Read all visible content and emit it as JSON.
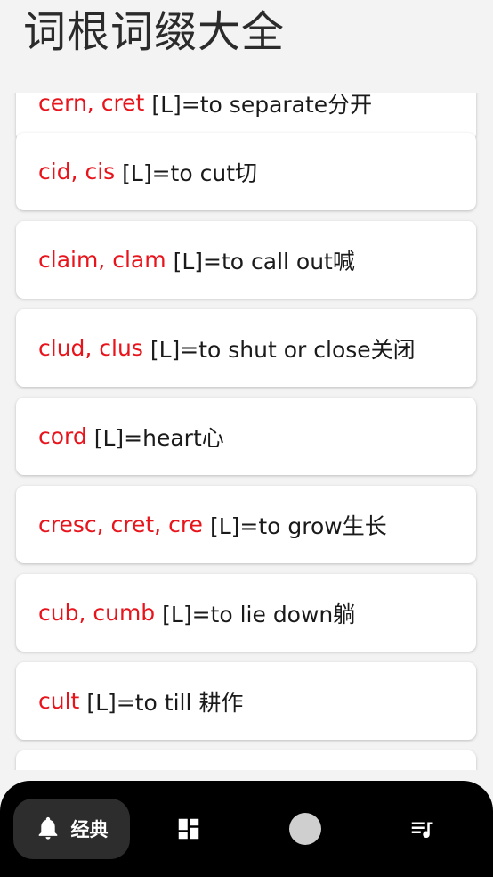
{
  "app": {
    "title": "词根词缀大全"
  },
  "entries": [
    {
      "root": "cern, cret",
      "gloss": "[L]=to separate分开"
    },
    {
      "root": "cid, cis",
      "gloss": "[L]=to cut切"
    },
    {
      "root": "claim, clam",
      "gloss": "[L]=to call out喊"
    },
    {
      "root": "clud, clus",
      "gloss": "[L]=to shut or close关闭"
    },
    {
      "root": "cord",
      "gloss": "[L]=heart心"
    },
    {
      "root": "cresc, cret, cre",
      "gloss": "[L]=to grow生长"
    },
    {
      "root": "cub, cumb",
      "gloss": "[L]=to lie down躺"
    },
    {
      "root": "cult",
      "gloss": "[L]=to till 耕作"
    },
    {
      "root": "",
      "gloss": ""
    }
  ],
  "bottom_nav": {
    "items": [
      {
        "id": "classic",
        "label": "经典",
        "icon": "bell-icon",
        "active": true
      },
      {
        "id": "dashboard",
        "label": "",
        "icon": "dashboard-icon",
        "active": false
      },
      {
        "id": "circle",
        "label": "",
        "icon": "circle-icon",
        "active": false
      },
      {
        "id": "playlist",
        "label": "",
        "icon": "playlist-icon",
        "active": false
      }
    ]
  },
  "colors": {
    "root": "#e8141c",
    "text": "#1a1a1a",
    "background": "#f3f3f3",
    "nav": "#000000"
  }
}
